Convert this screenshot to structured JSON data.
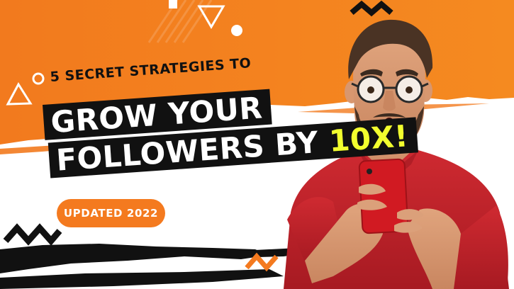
{
  "thumbnail": {
    "subtitle": "5 SECRET STRATEGIES TO",
    "headline_line1": "GROW YOUR",
    "headline_line2_prefix": "FOLLOWERS BY ",
    "headline_accent": "10X!",
    "badge_text": "UPDATED 2022"
  },
  "colors": {
    "orange": "#f47a1f",
    "black": "#111111",
    "white": "#ffffff",
    "accent_yellow": "#f2ff2e",
    "shirt_red": "#c8222b",
    "phone_red": "#d11a22"
  },
  "icons": [
    "triangle-icon",
    "circle-icon",
    "zigzag-icon",
    "stripes-decor"
  ],
  "image": {
    "subject": "surprised-man-with-phone-photo"
  }
}
